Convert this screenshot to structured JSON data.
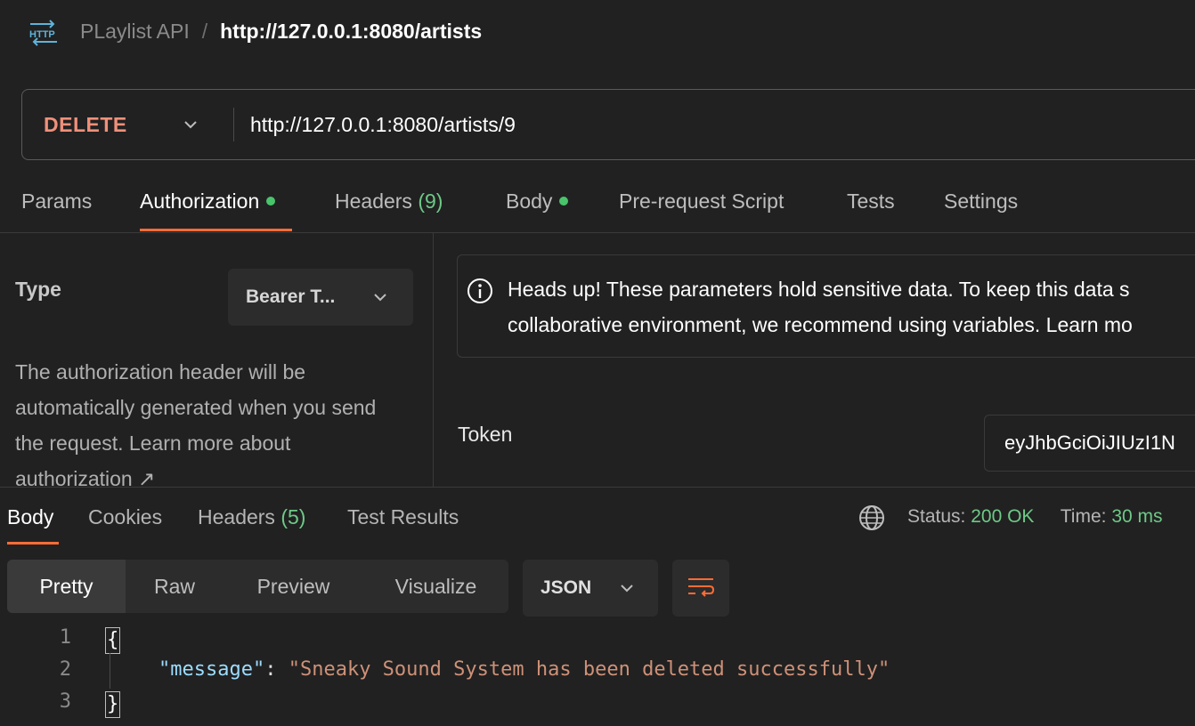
{
  "header": {
    "icon": "http-icon",
    "collection": "PLaylist API",
    "separator": "/",
    "request_name": "http://127.0.0.1:8080/artists"
  },
  "request": {
    "method": "DELETE",
    "url": "http://127.0.0.1:8080/artists/9"
  },
  "request_tabs": [
    {
      "label": "Params"
    },
    {
      "label": "Authorization",
      "dot": true,
      "active": true
    },
    {
      "label": "Headers",
      "count": "(9)"
    },
    {
      "label": "Body",
      "dot": true
    },
    {
      "label": "Pre-request Script"
    },
    {
      "label": "Tests"
    },
    {
      "label": "Settings"
    }
  ],
  "auth": {
    "type_label": "Type",
    "type_value": "Bearer T...",
    "description": "The authorization header will be automatically generated when you send the request. Learn more about",
    "link_text": "authorization ↗",
    "info_line1": "Heads up! These parameters hold sensitive data. To keep this data s",
    "info_line2": "collaborative environment, we recommend using variables. Learn mo",
    "token_label": "Token",
    "token_value": "eyJhbGciOiJIUzI1N"
  },
  "response": {
    "tabs": [
      {
        "label": "Body",
        "active": true
      },
      {
        "label": "Cookies"
      },
      {
        "label": "Headers",
        "count": "(5)"
      },
      {
        "label": "Test Results"
      }
    ],
    "status_label": "Status:",
    "status_value": "200 OK",
    "time_label": "Time:",
    "time_value": "30 ms",
    "views": [
      "Pretty",
      "Raw",
      "Preview",
      "Visualize"
    ],
    "format": "JSON",
    "code": {
      "line_numbers": [
        "1",
        "2",
        "3"
      ],
      "open_brace": "{",
      "key": "\"message\"",
      "colon": ": ",
      "value": "\"Sneaky Sound System has been deleted successfully\"",
      "close_brace": "}"
    }
  },
  "colors": {
    "background": "#212121",
    "accent": "#ff6c37",
    "method_delete": "#f0907a",
    "success": "#6ec987",
    "json_key": "#9cdcfe",
    "json_string": "#ce9178"
  }
}
